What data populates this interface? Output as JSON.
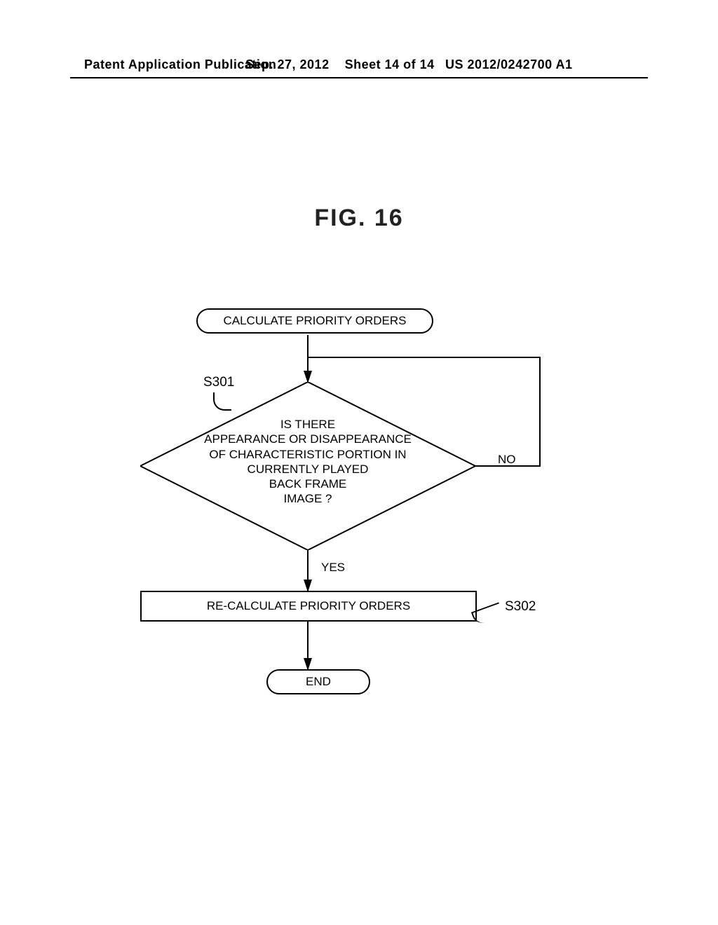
{
  "header": {
    "left": "Patent Application Publication",
    "mid_date": "Sep. 27, 2012",
    "mid_sheet": "Sheet 14 of 14",
    "right": "US 2012/0242700 A1"
  },
  "figure_title": "FIG. 16",
  "flowchart": {
    "start_label": "CALCULATE PRIORITY ORDERS",
    "end_label": "END",
    "decision_text_l1": "IS THERE",
    "decision_text_l2": "APPEARANCE OR DISAPPEARANCE",
    "decision_text_l3": "OF CHARACTERISTIC PORTION IN",
    "decision_text_l4": "CURRENTLY PLAYED",
    "decision_text_l5": "BACK FRAME",
    "decision_text_l6": "IMAGE ?",
    "process_label": "RE-CALCULATE PRIORITY ORDERS",
    "step_s301": "S301",
    "step_s302": "S302",
    "yes_label": "YES",
    "no_label": "NO"
  },
  "chart_data": {
    "type": "flowchart",
    "title": "FIG. 16",
    "nodes": [
      {
        "id": "start",
        "shape": "terminator",
        "text": "CALCULATE PRIORITY ORDERS"
      },
      {
        "id": "d1",
        "shape": "decision",
        "step": "S301",
        "text": "IS THERE APPEARANCE OR DISAPPEARANCE OF CHARACTERISTIC PORTION IN CURRENTLY PLAYED BACK FRAME IMAGE ?"
      },
      {
        "id": "p1",
        "shape": "process",
        "step": "S302",
        "text": "RE-CALCULATE PRIORITY ORDERS"
      },
      {
        "id": "end",
        "shape": "terminator",
        "text": "END"
      }
    ],
    "edges": [
      {
        "from": "start",
        "to": "d1",
        "label": ""
      },
      {
        "from": "d1",
        "to": "p1",
        "label": "YES"
      },
      {
        "from": "d1",
        "to": "d1",
        "label": "NO"
      },
      {
        "from": "p1",
        "to": "end",
        "label": ""
      }
    ]
  }
}
